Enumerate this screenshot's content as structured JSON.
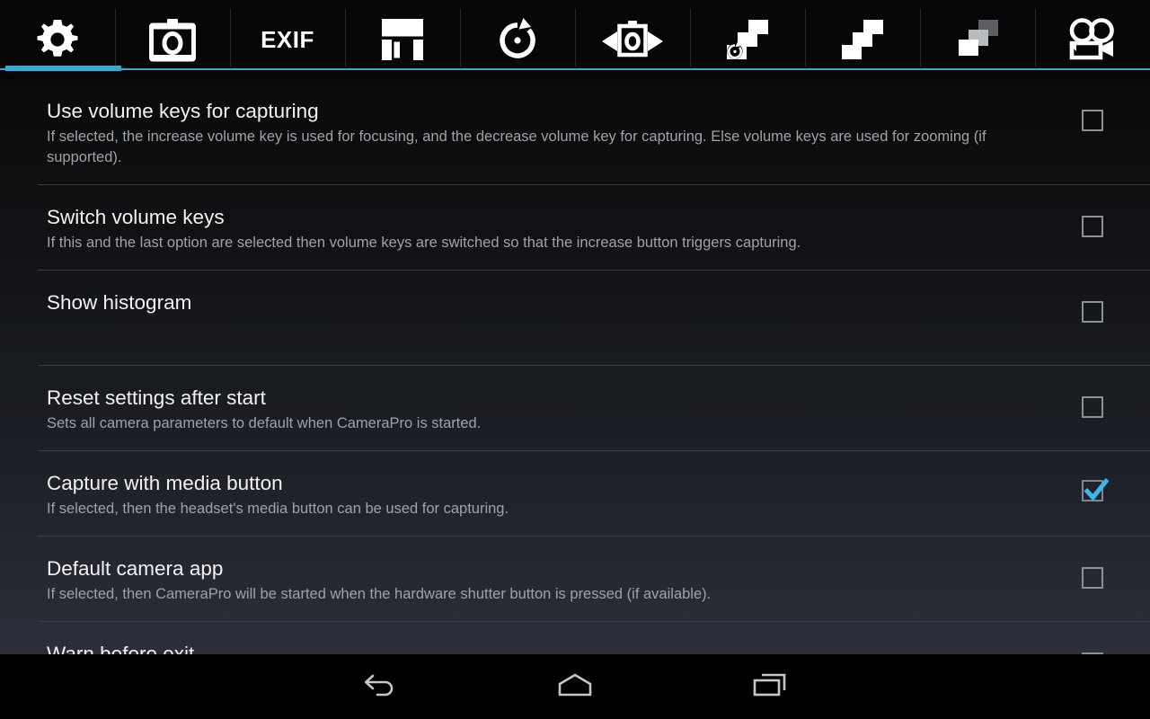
{
  "app": {
    "name": "CameraPro",
    "accent_color": "#35abdc",
    "background_top": "#0a0a0b",
    "background_bottom": "#2c2f39"
  },
  "tabbar": {
    "active_index": 0,
    "tabs": [
      {
        "id": "general",
        "icon": "gear-icon",
        "label": "",
        "active": true
      },
      {
        "id": "camera",
        "icon": "camera-icon",
        "label": "",
        "active": false
      },
      {
        "id": "exif",
        "icon": "exif-text-icon",
        "label": "EXIF",
        "active": false
      },
      {
        "id": "storage",
        "icon": "floppy-disk-icon",
        "label": "",
        "active": false
      },
      {
        "id": "selftimer",
        "icon": "timer-icon",
        "label": "",
        "active": false
      },
      {
        "id": "panorama",
        "icon": "panorama-camera-icon",
        "label": "",
        "active": false
      },
      {
        "id": "timelapse",
        "icon": "burst-timer-icon",
        "label": "",
        "active": false
      },
      {
        "id": "burst",
        "icon": "burst-icon",
        "label": "",
        "active": false
      },
      {
        "id": "bracketing",
        "icon": "bracketing-icon",
        "label": "",
        "active": false
      },
      {
        "id": "video",
        "icon": "video-camera-icon",
        "label": "",
        "active": false
      }
    ]
  },
  "settings": {
    "rows": [
      {
        "title": "Use volume keys for capturing",
        "summary": "If selected, the increase volume key is used for focusing, and the decrease volume key for capturing. Else volume keys are used for zooming (if supported).",
        "checked": false
      },
      {
        "title": "Switch volume keys",
        "summary": "If this and the last option are selected then volume keys are switched so that the increase button triggers capturing.",
        "checked": false
      },
      {
        "title": "Show histogram",
        "summary": "",
        "checked": false
      },
      {
        "title": "Reset settings after start",
        "summary": "Sets all camera parameters to default when CameraPro is started.",
        "checked": false
      },
      {
        "title": "Capture with media button",
        "summary": "If selected, then the headset's media button can be used for capturing.",
        "checked": true
      },
      {
        "title": "Default camera app",
        "summary": "If selected, then CameraPro will be started when the hardware shutter button is pressed (if available).",
        "checked": false
      },
      {
        "title": "Warn before exit",
        "summary": "",
        "checked": false
      }
    ]
  },
  "navbar": {
    "back_label": "back-navigation",
    "home_label": "home",
    "recents_label": "recent-apps"
  }
}
